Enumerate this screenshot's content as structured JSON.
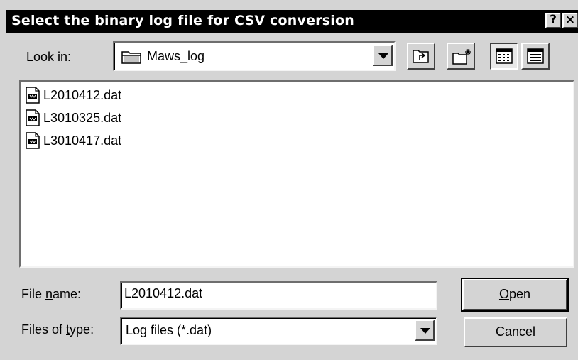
{
  "window": {
    "title": "Select the binary log file for CSV conversion",
    "help_glyph": "?",
    "close_glyph": "×"
  },
  "toolbar": {
    "lookin_label_pre": "Look ",
    "lookin_label_hot": "i",
    "lookin_label_post": "n:",
    "folder_icon": "folder-icon",
    "current_folder": "Maws_log",
    "tools": [
      "up-one-level-icon",
      "create-new-folder-icon",
      "list-view-icon",
      "details-view-icon"
    ],
    "active_view": "list-view"
  },
  "files": [
    {
      "name": "L2010412.dat",
      "icon": "data-file-icon"
    },
    {
      "name": "L3010325.dat",
      "icon": "data-file-icon"
    },
    {
      "name": "L3010417.dat",
      "icon": "data-file-icon"
    }
  ],
  "form": {
    "filename_label_pre": "File ",
    "filename_label_hot": "n",
    "filename_label_post": "ame:",
    "filename_value": "L2010412.dat",
    "filetype_label_pre": "Files of ",
    "filetype_label_hot": "t",
    "filetype_label_post": "ype:",
    "filetype_value": "Log files (*.dat)"
  },
  "buttons": {
    "open_hot": "O",
    "open_rest": "pen",
    "cancel": "Cancel"
  }
}
